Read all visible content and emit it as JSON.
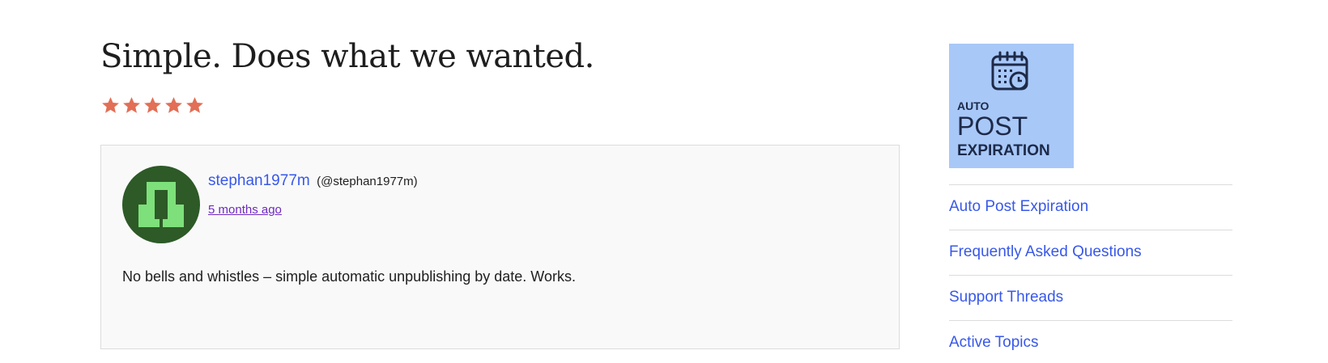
{
  "review": {
    "title": "Simple. Does what we wanted.",
    "rating": 5,
    "max_rating": 5,
    "star_color": "#e26f56",
    "author_name": "stephan1977m",
    "author_handle": "(@stephan1977m)",
    "date": "5 months ago",
    "body": "No bells and whistles – simple automatic unpublishing by date. Works."
  },
  "avatar": {
    "background": "#2d5a27",
    "foreground": "#7ee07a"
  },
  "plugin": {
    "banner_line1": "AUTO",
    "banner_line2": "POST",
    "banner_line3": "EXPIRATION",
    "banner_color": "#a8c8f8",
    "icon": "calendar-clock-icon"
  },
  "sidebar_nav": {
    "items": [
      {
        "label": "Auto Post Expiration"
      },
      {
        "label": "Frequently Asked Questions"
      },
      {
        "label": "Support Threads"
      },
      {
        "label": "Active Topics"
      }
    ]
  }
}
